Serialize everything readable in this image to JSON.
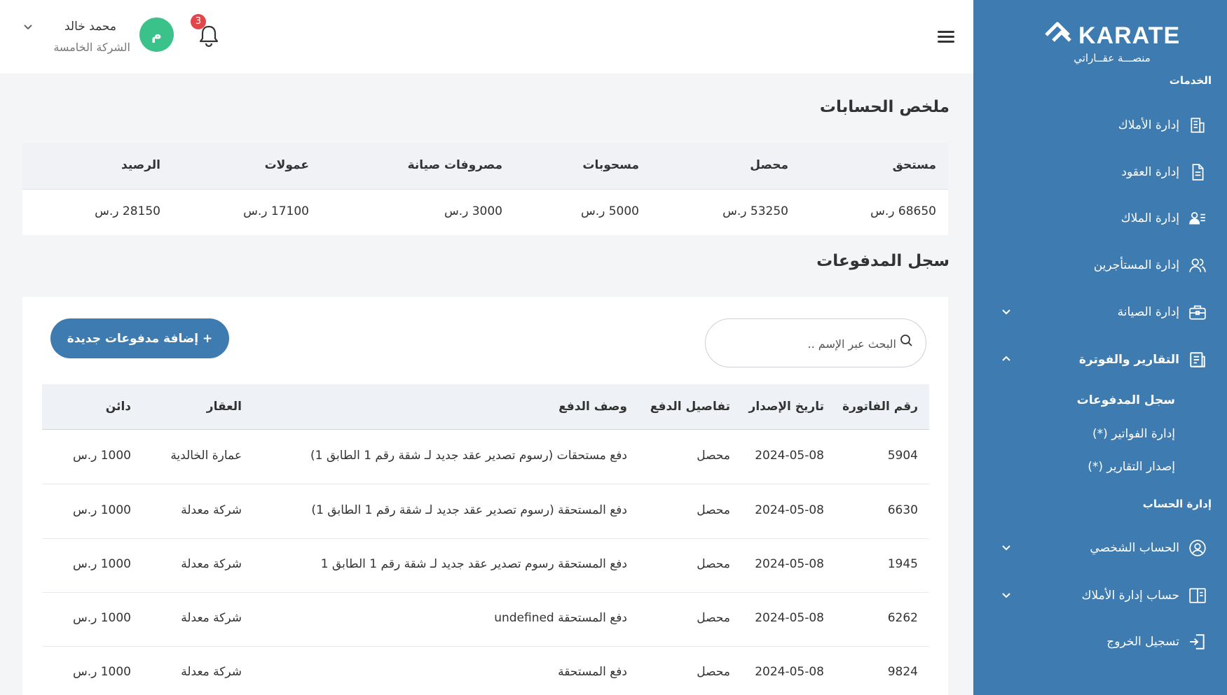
{
  "sidebar": {
    "logo_word": "KARATE",
    "logo_sub": "منصـــة عقــاراتي",
    "services_title": "الخدمات",
    "account_title": "إدارة الحساب",
    "items": [
      {
        "label": "إدارة الأملاك",
        "icon": "building-icon"
      },
      {
        "label": "إدارة العقود",
        "icon": "document-icon"
      },
      {
        "label": "إدارة الملاك",
        "icon": "owners-list-icon"
      },
      {
        "label": "إدارة المستأجرين",
        "icon": "users-icon"
      },
      {
        "label": "إدارة الصيانة",
        "icon": "toolbox-icon"
      },
      {
        "label": "التقارير والفوترة",
        "icon": "report-icon"
      }
    ],
    "sub_items": [
      {
        "label": "سجل المدفوعات"
      },
      {
        "label": "إدارة الفواتير (*)"
      },
      {
        "label": "إصدار التقارير (*)"
      }
    ],
    "account_items": [
      {
        "label": "الحساب الشخصي",
        "icon": "user-circle-icon"
      },
      {
        "label": "حساب إدارة الأملاك",
        "icon": "book-icon"
      },
      {
        "label": "تسجيل الخروج",
        "icon": "logout-icon"
      }
    ]
  },
  "header": {
    "notification_count": "3",
    "avatar_initial": "م",
    "user_name": "محمد خالد",
    "company": "الشركة الخامسة"
  },
  "summary": {
    "title": "ملخص الحسابات",
    "headers": [
      "مستحق",
      "محصل",
      "مسحوبات",
      "مصروفات صيانة",
      "عمولات",
      "الرصيد"
    ],
    "values": [
      "68650 ر.س",
      "53250 ر.س",
      "5000 ر.س",
      "3000 ر.س",
      "17100 ر.س",
      "28150 ر.س"
    ]
  },
  "payments": {
    "title": "سجل المدفوعات",
    "search_placeholder": "البحث عبر الإسم ..",
    "add_button": "+ إضافة مدفوعات جديدة",
    "columns": [
      "رقم الفاتورة",
      "تاريخ الإصدار",
      "تفاصيل الدفع",
      "وصف الدفع",
      "العقار",
      "دائن"
    ],
    "rows": [
      [
        "5904",
        "2024-05-08",
        "محصل",
        "دفع مستحقات (رسوم تصدير عقد جديد لـ شقة رقم 1 الطابق 1)",
        "عمارة الخالدية",
        "1000 ر.س"
      ],
      [
        "6630",
        "2024-05-08",
        "محصل",
        "دفع المستحقة (رسوم تصدير عقد جديد لـ شقة رقم 1 الطابق 1)",
        "شركة معدلة",
        "1000 ر.س"
      ],
      [
        "1945",
        "2024-05-08",
        "محصل",
        "دفع المستحقة رسوم تصدير عقد جديد لـ شقة رقم 1 الطابق 1",
        "شركة معدلة",
        "1000 ر.س"
      ],
      [
        "6262",
        "2024-05-08",
        "محصل",
        "دفع المستحقة undefined",
        "شركة معدلة",
        "1000 ر.س"
      ],
      [
        "9824",
        "2024-05-08",
        "محصل",
        "دفع المستحقة",
        "شركة معدلة",
        "1000 ر.س"
      ]
    ]
  },
  "colors": {
    "primary": "#3d7bb0",
    "avatar": "#3bc28a",
    "badge": "#e2464b"
  }
}
